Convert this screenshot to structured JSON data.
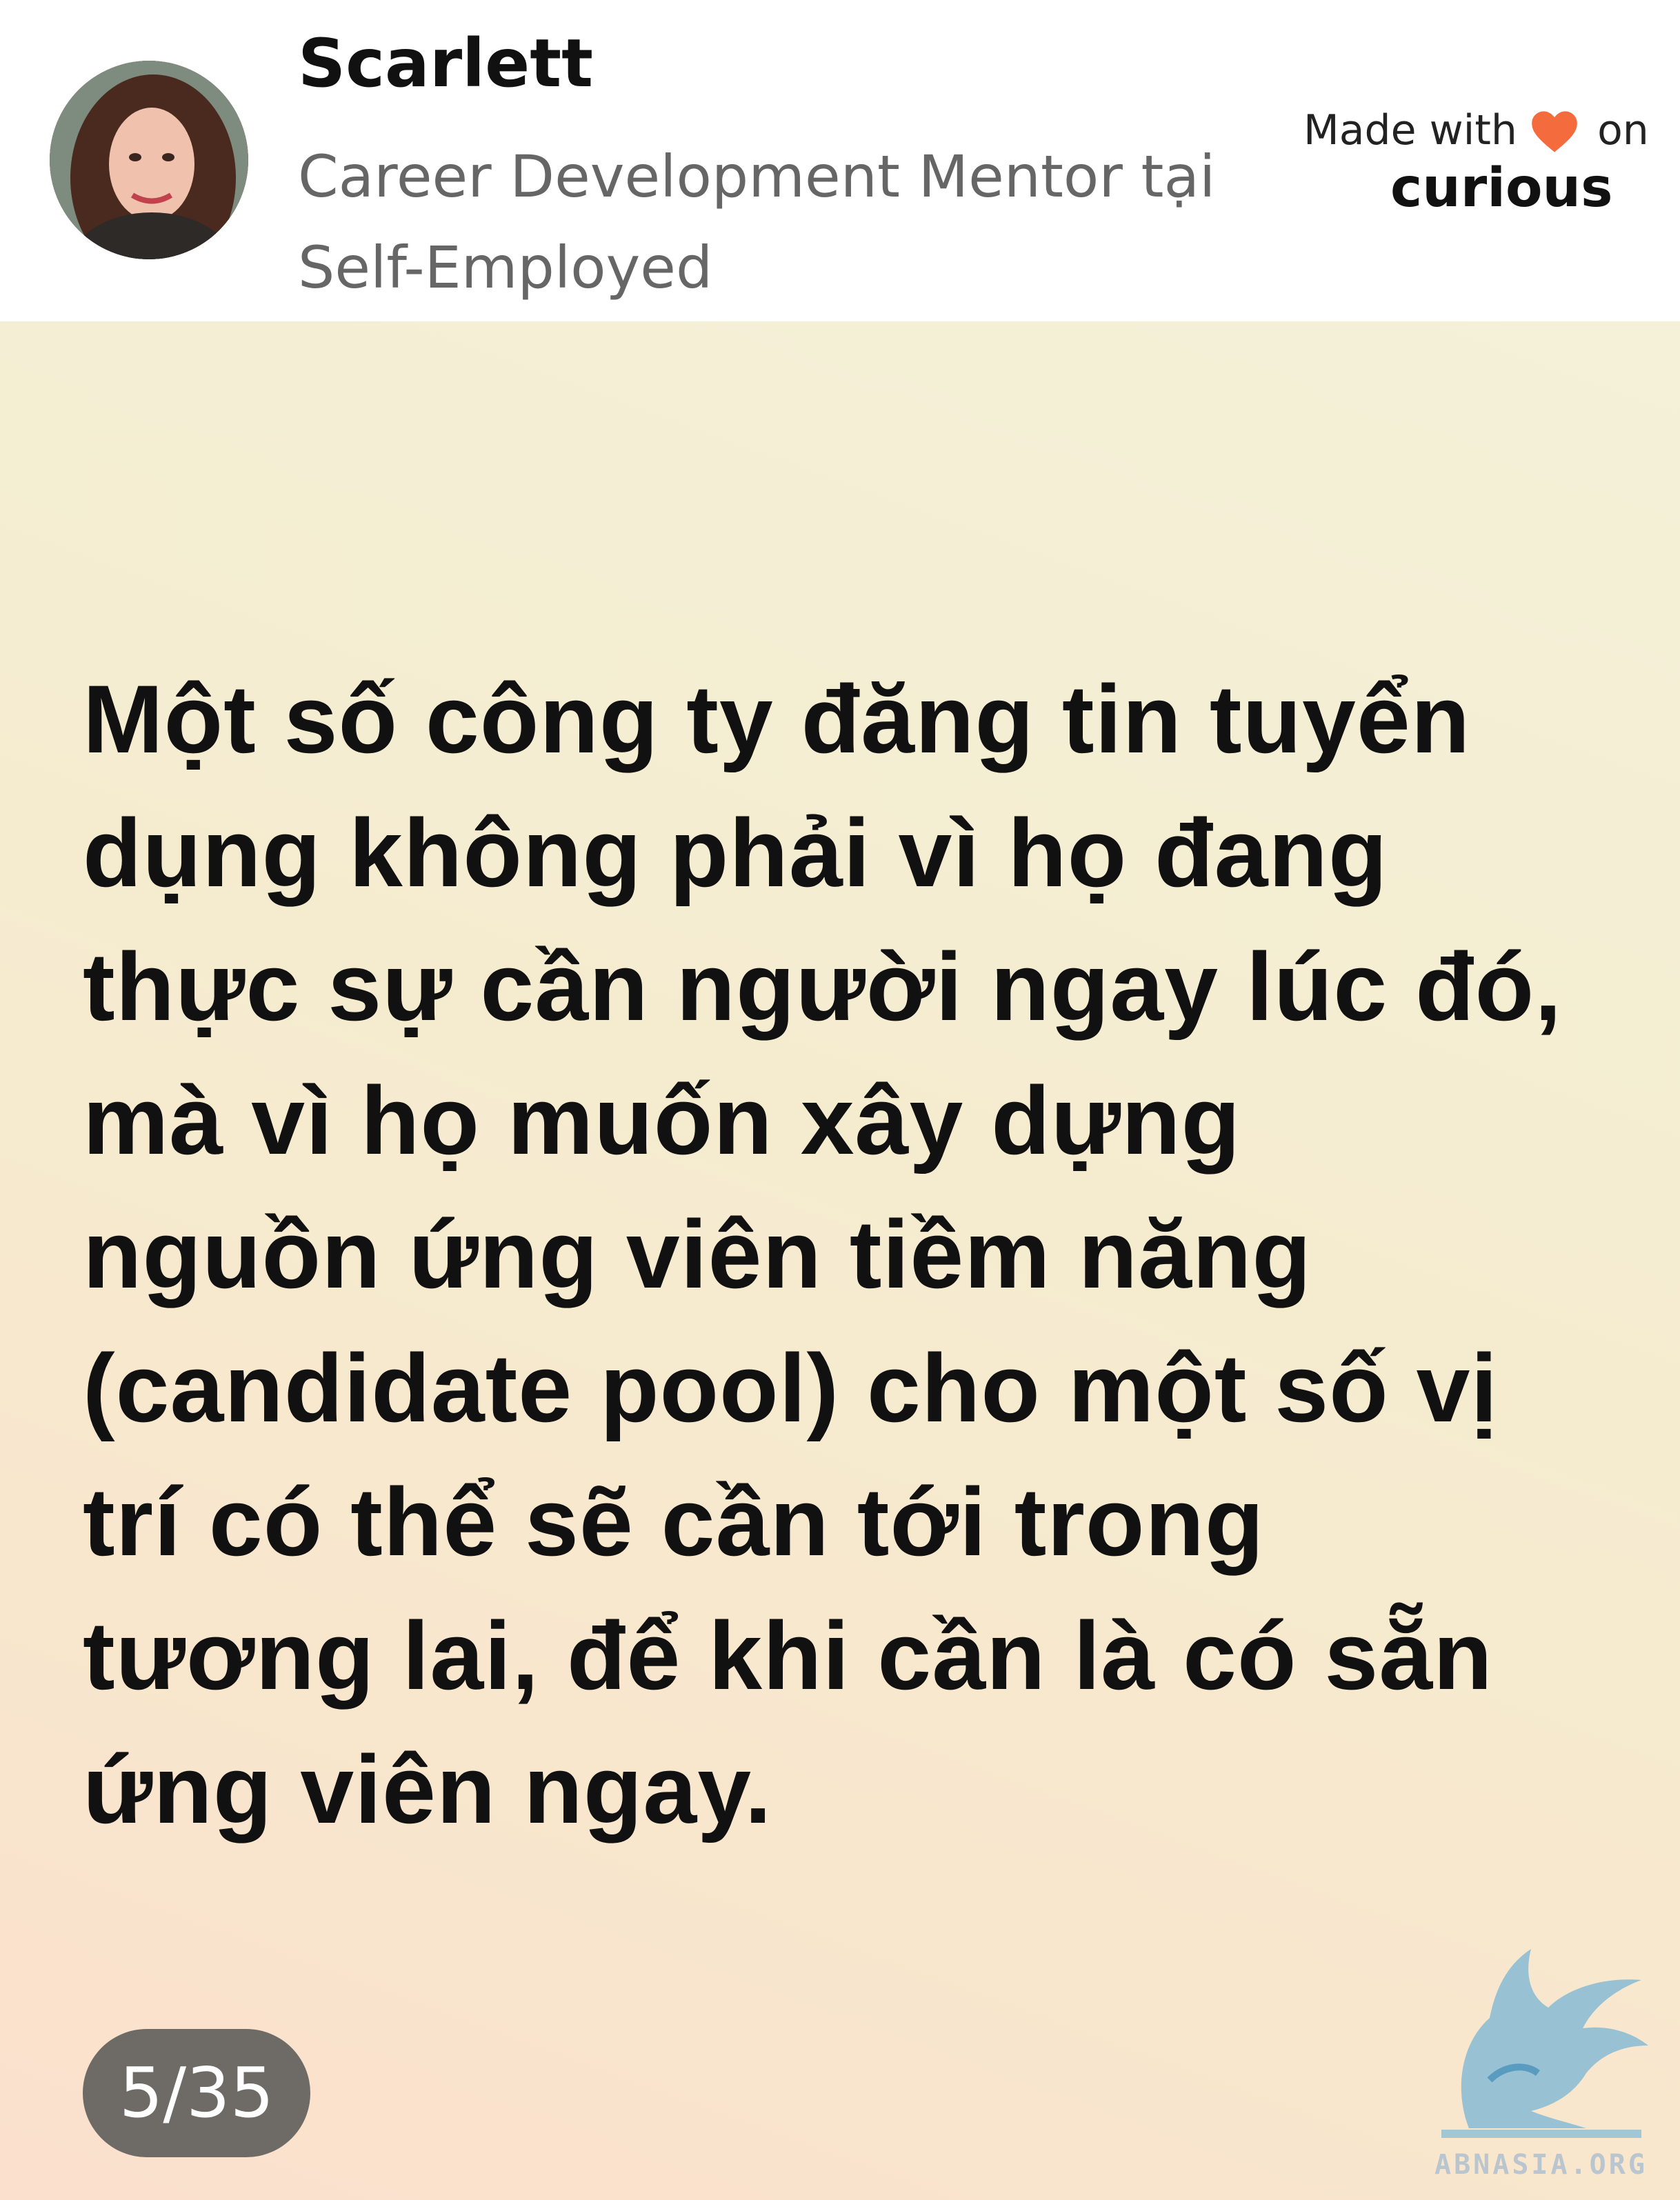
{
  "header": {
    "author_name": "Scarlett",
    "author_title": "Career Development Mentor tại Self-Employed",
    "made_with": "Made with",
    "made_on": "on",
    "brand": "curious",
    "heart_icon": "heart-icon",
    "heart_color": "#f46b3e"
  },
  "slide": {
    "text": "Một số công ty đăng tin tuyển dụng không phải vì họ đang thực sự cần người ngay lúc đó, mà vì họ muốn xây dựng nguồn ứng viên tiềm năng (candidate pool) cho một số vị trí có thể sẽ cần tới trong tương lai, để khi cần là có sẵn ứng viên ngay.",
    "page_counter": "5/35",
    "background_color": "#f5efd6"
  },
  "watermark": {
    "text": "ABNASIA.ORG",
    "icon": "griffin-logo-icon",
    "color": "#7fb8d6"
  }
}
